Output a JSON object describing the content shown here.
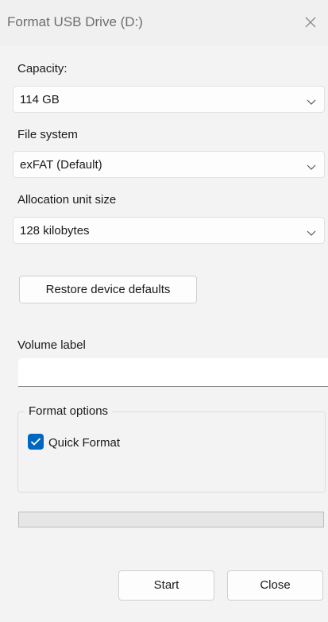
{
  "window": {
    "title": "Format USB Drive (D:)"
  },
  "capacity": {
    "label": "Capacity:",
    "value": "114 GB"
  },
  "file_system": {
    "label": "File system",
    "value": "exFAT (Default)"
  },
  "allocation": {
    "label": "Allocation unit size",
    "value": "128 kilobytes"
  },
  "restore_button": "Restore device defaults",
  "volume": {
    "label": "Volume label",
    "value": ""
  },
  "format_options": {
    "title": "Format options",
    "quick_format": {
      "label": "Quick Format",
      "checked": true
    }
  },
  "progress": {
    "fraction": 0
  },
  "buttons": {
    "start": "Start",
    "close": "Close"
  },
  "colors": {
    "accent": "#0067c0",
    "background": "#f3f3f3"
  },
  "icons": {
    "close": "close-icon",
    "dropdown": "chevron-down-icon",
    "check": "checkmark-icon"
  }
}
